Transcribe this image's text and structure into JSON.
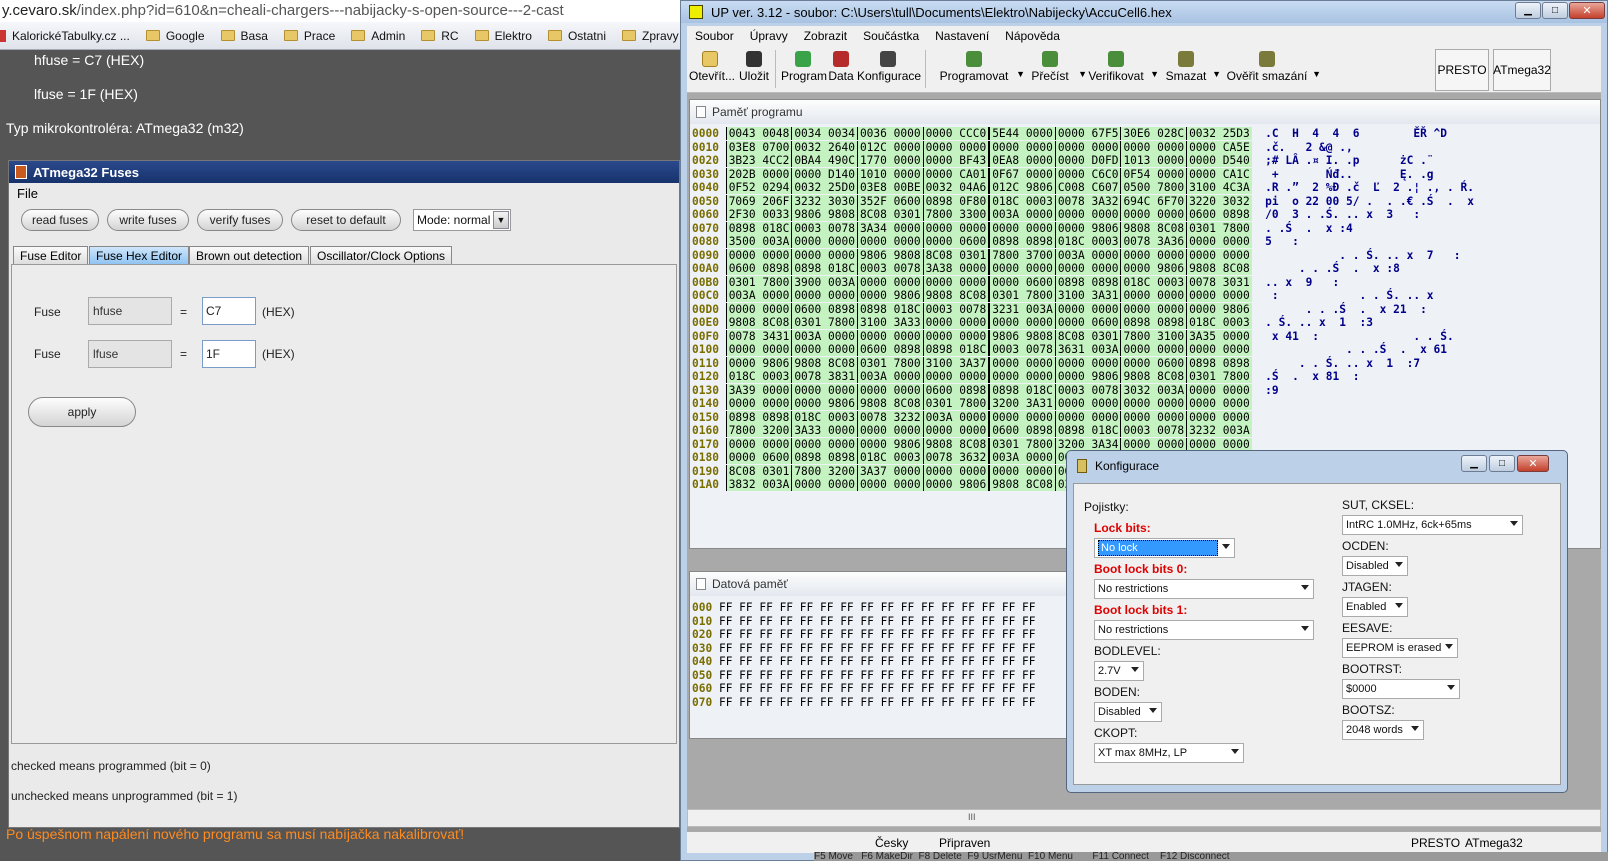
{
  "browser": {
    "url_host": "y.cevaro.sk",
    "url_path": "/index.php?id=610&n=cheali-chargers---nabijacky-s-open-source---2-cast",
    "bookmarks": [
      "KalorickéTabulky.cz ...",
      "Google",
      "Basa",
      "Prace",
      "Admin",
      "RC",
      "Elektro",
      "Ostatni",
      "Zpravy"
    ],
    "bookmarks_more": "»"
  },
  "webpage": {
    "hfuse_line": "hfuse = C7 (HEX)",
    "lfuse_line": "lfuse = 1F (HEX)",
    "mcu_line": "Typ mikrokontroléra: ATmega32 (m32)",
    "bottom_note": "Po úspešnom napálení nového programu sa musí nabíjačka nakalibrovať!"
  },
  "fuses_window": {
    "title": "ATmega32 Fuses",
    "menu_file": "File",
    "buttons": [
      "read fuses",
      "write fuses",
      "verify fuses",
      "reset to default"
    ],
    "mode_value": "Mode: normal",
    "tabs": [
      "Fuse Editor",
      "Fuse Hex Editor",
      "Brown out detection",
      "Oscillator/Clock Options"
    ],
    "rows": [
      {
        "label": "Fuse",
        "name": "hfuse",
        "eq": "=",
        "value": "C7",
        "unit": "(HEX)"
      },
      {
        "label": "Fuse",
        "name": "lfuse",
        "eq": "=",
        "value": "1F",
        "unit": "(HEX)"
      }
    ],
    "apply": "apply",
    "note1": "checked means programmed (bit = 0)",
    "note2": "unchecked means unprogrammed (bit = 1)"
  },
  "up_window": {
    "title": "UP ver. 3.12 - soubor: C:\\Users\\tull\\Documents\\Elektro\\Nabijecky\\AccuCell6.hex",
    "menu": [
      "Soubor",
      "Úpravy",
      "Zobrazit",
      "Součástka",
      "Nastavení",
      "Nápověda"
    ],
    "toolbar": [
      "Otevřít...",
      "Uložit",
      "Program",
      "Data",
      "Konfigurace",
      "Programovat",
      "Přečíst",
      "Verifikovat",
      "Smazat",
      "Ověřit smazání"
    ],
    "device_boxes": [
      "PRESTO",
      "ATmega32"
    ],
    "program_panel_title": "Paměť programu",
    "data_panel_title": "Datová paměť",
    "program_rows": [
      {
        "a": "0000",
        "h": [
          "0043 0048",
          "0034 0034",
          "0036 0000",
          "0000 CCC0",
          "5E44 0000",
          "0000 67F5",
          "30E6 028C",
          "0032 25D3"
        ],
        "t": ".C  H  4  4  6        ĚŘ ^D"
      },
      {
        "a": "0010",
        "h": [
          "03E8 0700",
          "0032 2640",
          "012C 0000",
          "0000 0000",
          "0000 0000",
          "0000 0000",
          "0000 0000",
          "0000 CA5E"
        ],
        "t": ".č.   2 &@ .,"
      },
      {
        "a": "0020",
        "h": [
          "3B23 4CC2",
          "0BA4 490C",
          "1770 0000",
          "0000 BF43",
          "0EA8 0000",
          "0000 D0FD",
          "1013 0000",
          "0000 D540"
        ],
        "t": ";# LÂ .¤ I. .p      żC .¨"
      },
      {
        "a": "0030",
        "h": [
          "202B 0000",
          "0000 D140",
          "1010 0000",
          "0000 CA01",
          "0F67 0000",
          "0000 C6C0",
          "0F54 0000",
          "0000 CA1C"
        ],
        "t": " +       Ńđ..       Ę. .g"
      },
      {
        "a": "0040",
        "h": [
          "0F52 0294",
          "0032 25D0",
          "03E8 00BE",
          "0032 04A6",
          "012C 9806",
          "C008 C607",
          "0500 7800",
          "3100 4C3A"
        ],
        "t": ".R .”  2 %Đ .č  Ľ  2 .¦ ., . Ŕ."
      },
      {
        "a": "0050",
        "h": [
          "7069 206F",
          "3232 3030",
          "352F 0600",
          "0898 0F80",
          "018C 0003",
          "0078 3A32",
          "694C 6F70",
          "3220 3032"
        ],
        "t": "pi  o 22 00 5/ .  . .€ .Ś  .  x"
      },
      {
        "a": "0060",
        "h": [
          "2F30 0033",
          "9806 9808",
          "8C08 0301",
          "7800 3300",
          "003A 0000",
          "0000 0000",
          "0000 0000",
          "0600 0898"
        ],
        "t": "/0  3 . .Ś. .. x  3   :"
      },
      {
        "a": "0070",
        "h": [
          "0898 018C",
          "0003 0078",
          "3A34 0000",
          "0000 0000",
          "0000 0000",
          "0000 9806",
          "9808 8C08",
          "0301 7800"
        ],
        "t": ". .Ś  .  x :4"
      },
      {
        "a": "0080",
        "h": [
          "3500 003A",
          "0000 0000",
          "0000 0000",
          "0000 0600",
          "0898 0898",
          "018C 0003",
          "0078 3A36",
          "0000 0000"
        ],
        "t": "5   :"
      },
      {
        "a": "0090",
        "h": [
          "0000 0000",
          "0000 0000",
          "9806 9808",
          "8C08 0301",
          "7800 3700",
          "003A 0000",
          "0000 0000",
          "0000 0000"
        ],
        "t": "           . . Ś. .. x  7   :"
      },
      {
        "a": "00A0",
        "h": [
          "0600 0898",
          "0898 018C",
          "0003 0078",
          "3A38 0000",
          "0000 0000",
          "0000 0000",
          "0000 9806",
          "9808 8C08"
        ],
        "t": "     . . .Ś  .  x :8"
      },
      {
        "a": "00B0",
        "h": [
          "0301 7800",
          "3900 003A",
          "0000 0000",
          "0000 0000",
          "0000 0600",
          "0898 0898",
          "018C 0003",
          "0078 3031"
        ],
        "t": ".. x  9   :"
      },
      {
        "a": "00C0",
        "h": [
          "003A 0000",
          "0000 0000",
          "0000 9806",
          "9808 8C08",
          "0301 7800",
          "3100 3A31",
          "0000 0000",
          "0000 0000"
        ],
        "t": " :            . . Ś. .. x"
      },
      {
        "a": "00D0",
        "h": [
          "0000 0000",
          "0600 0898",
          "0898 018C",
          "0003 0078",
          "3231 003A",
          "0000 0000",
          "0000 0000",
          "0000 9806"
        ],
        "t": "      . . .Ś  .  x 21  :"
      },
      {
        "a": "00E0",
        "h": [
          "9808 8C08",
          "0301 7800",
          "3100 3A33",
          "0000 0000",
          "0000 0000",
          "0000 0600",
          "0898 0898",
          "018C 0003"
        ],
        "t": ". Ś. .. x  1  :3"
      },
      {
        "a": "00F0",
        "h": [
          "0078 3431",
          "003A 0000",
          "0000 0000",
          "0000 0000",
          "9806 9808",
          "8C08 0301",
          "7800 3100",
          "3A35 0000"
        ],
        "t": " x 41  :              . . Ś."
      },
      {
        "a": "0100",
        "h": [
          "0000 0000",
          "0000 0000",
          "0600 0898",
          "0898 018C",
          "0003 0078",
          "3631 003A",
          "0000 0000",
          "0000 0000"
        ],
        "t": "            . . .Ś  .  x 61"
      },
      {
        "a": "0110",
        "h": [
          "0000 9806",
          "9808 8C08",
          "0301 7800",
          "3100 3A37",
          "0000 0000",
          "0000 0000",
          "0000 0600",
          "0898 0898"
        ],
        "t": "     . . Ś. .. x  1  :7"
      },
      {
        "a": "0120",
        "h": [
          "018C 0003",
          "0078 3831",
          "003A 0000",
          "0000 0000",
          "0000 0000",
          "0000 9806",
          "9808 8C08",
          "0301 7800"
        ],
        "t": ".Ś  .  x 81  :"
      },
      {
        "a": "0130",
        "h": [
          "3A39 0000",
          "0000 0000",
          "0000 0000",
          "0600 0898",
          "0898 018C",
          "0003 0078",
          "3032 003A",
          "0000 0000"
        ],
        "t": ":9"
      },
      {
        "a": "0140",
        "h": [
          "0000 0000",
          "0000 9806",
          "9808 8C08",
          "0301 7800",
          "3200 3A31",
          "0000 0000",
          "0000 0000",
          "0000 0000"
        ],
        "t": ""
      },
      {
        "a": "0150",
        "h": [
          "0898 0898",
          "018C 0003",
          "0078 3232",
          "003A 0000",
          "0000 0000",
          "0000 0000",
          "0000 0000",
          "0000 0000"
        ],
        "t": ""
      },
      {
        "a": "0160",
        "h": [
          "7800 3200",
          "3A33 0000",
          "0000 0000",
          "0000 0000",
          "0600 0898",
          "0898 018C",
          "0003 0078",
          "3232 003A"
        ],
        "t": ""
      },
      {
        "a": "0170",
        "h": [
          "0000 0000",
          "0000 0000",
          "0000 9806",
          "9808 8C08",
          "0301 7800",
          "3200 3A34",
          "0000 0000",
          "0000 0000"
        ],
        "t": ""
      },
      {
        "a": "0180",
        "h": [
          "0000 0600",
          "0898 0898",
          "018C 0003",
          "0078 3632",
          "003A 0000",
          "0000 0000",
          "0000 0000",
          "0000 0000"
        ],
        "t": ""
      },
      {
        "a": "0190",
        "h": [
          "8C08 0301",
          "7800 3200",
          "3A37 0000",
          "0000 0000",
          "0000 0000",
          "0000 0000",
          "0000 0000",
          "0000 0000"
        ],
        "t": ""
      },
      {
        "a": "01A0",
        "h": [
          "3832 003A",
          "0000 0000",
          "0000 0000",
          "0000 9806",
          "9808 8C08",
          "0301 7800",
          "3200 3A38",
          "0000 0000"
        ],
        "t": ""
      }
    ],
    "data_rows": [
      {
        "a": "000",
        "h": "FF FF FF FF FF FF FF FF FF FF FF FF FF FF FF FF"
      },
      {
        "a": "010",
        "h": "FF FF FF FF FF FF FF FF FF FF FF FF FF FF FF FF"
      },
      {
        "a": "020",
        "h": "FF FF FF FF FF FF FF FF FF FF FF FF FF FF FF FF"
      },
      {
        "a": "030",
        "h": "FF FF FF FF FF FF FF FF FF FF FF FF FF FF FF FF"
      },
      {
        "a": "040",
        "h": "FF FF FF FF FF FF FF FF FF FF FF FF FF FF FF FF"
      },
      {
        "a": "050",
        "h": "FF FF FF FF FF FF FF FF FF FF FF FF FF FF FF FF"
      },
      {
        "a": "060",
        "h": "FF FF FF FF FF FF FF FF FF FF FF FF FF FF FF FF"
      },
      {
        "a": "070",
        "h": "FF FF FF FF FF FF FF FF FF FF FF FF FF FF FF FF"
      }
    ],
    "status": {
      "lang": "Česky",
      "state": "Připraven",
      "programmer": "PRESTO",
      "device": "ATmega32"
    },
    "scroll_grip": "III"
  },
  "konfigurace": {
    "title": "Konfigurace",
    "pojistky": "Pojistky:",
    "lock_bits_label": "Lock bits:",
    "lock_bits_value": "No lock",
    "boot0_label": "Boot lock bits 0:",
    "boot0_value": "No restrictions",
    "boot1_label": "Boot lock bits 1:",
    "boot1_value": "No restrictions",
    "bodlevel_label": "BODLEVEL:",
    "bodlevel_value": "2.7V",
    "boden_label": "BODEN:",
    "boden_value": "Disabled",
    "ckopt_label": "CKOPT:",
    "ckopt_value": "XT max 8MHz, LP",
    "sut_label": "SUT, CKSEL:",
    "sut_value": "IntRC 1.0MHz, 6ck+65ms",
    "ocden_label": "OCDEN:",
    "ocden_value": "Disabled",
    "jtagen_label": "JTAGEN:",
    "jtagen_value": "Enabled",
    "eesave_label": "EESAVE:",
    "eesave_value": "EEPROM is erased",
    "bootrst_label": "BOOTRST:",
    "bootrst_value": "$0000",
    "bootsz_label": "BOOTSZ:",
    "bootsz_value": "2048 words"
  },
  "taskbar_hint": "F5 Move   F6 MakeDir  F8 Delete  F9 UsrMenu  F10 Menu       F11 Connect    F12 Disconnect",
  "colors": {
    "hex_bg": "#c4f2c0",
    "address": "#7a6e00",
    "ascii": "#00008a",
    "lock_label": "#e00000",
    "title_bar": "#17326c",
    "note_orange": "#ff8a1e"
  }
}
